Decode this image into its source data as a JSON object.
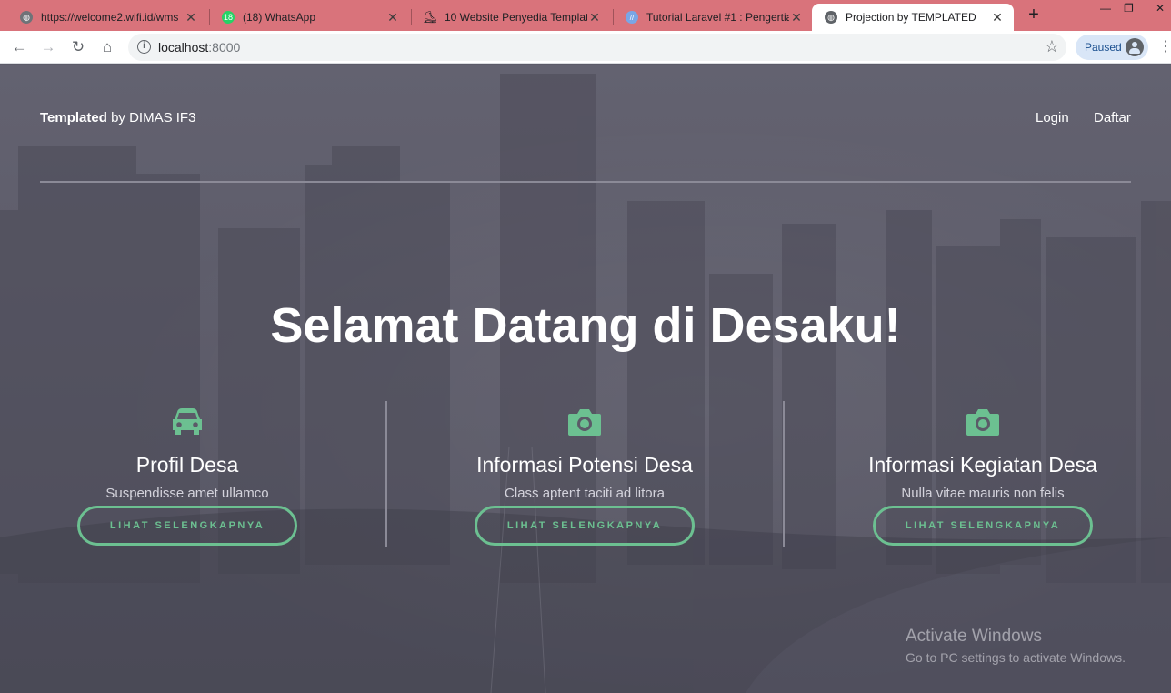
{
  "browser": {
    "tabs": [
      {
        "title": "https://welcome2.wifi.id/wms",
        "icon": "globe-icon",
        "active": false
      },
      {
        "title": "(18) WhatsApp",
        "icon": "whatsapp-icon",
        "badge": "18",
        "active": false
      },
      {
        "title": "10 Website Penyedia Templat",
        "icon": "site-icon",
        "active": false
      },
      {
        "title": "Tutorial Laravel #1 : Pengertia",
        "icon": "code-icon",
        "active": false
      },
      {
        "title": "Projection by TEMPLATED",
        "icon": "globe-icon",
        "active": true
      }
    ],
    "address": {
      "host": "localhost",
      "port": ":8000"
    },
    "profile_label": "Paused"
  },
  "header": {
    "brand_strong": "Templated",
    "brand_rest": " by DIMAS IF3",
    "nav": [
      {
        "label": "Login"
      },
      {
        "label": "Daftar"
      }
    ]
  },
  "hero": {
    "title": "Selamat Datang di Desaku!"
  },
  "features": [
    {
      "icon": "car-icon",
      "title": "Profil Desa",
      "text": "Suspendisse amet ullamco",
      "button": "LIHAT SELENGKAPNYA"
    },
    {
      "icon": "camera-icon",
      "title": "Informasi Potensi Desa",
      "text": "Class aptent taciti ad litora",
      "button": "LIHAT SELENGKAPNYA"
    },
    {
      "icon": "camera-icon",
      "title": "Informasi Kegiatan Desa",
      "text": "Nulla vitae mauris non felis",
      "button": "LIHAT SELENGKAPNYA"
    }
  ],
  "watermark": {
    "line1": "Activate Windows",
    "line2": "Go to PC settings to activate Windows."
  },
  "colors": {
    "accent": "#6cc091",
    "tabbar": "#d9737b",
    "overlay": "#5b5a68"
  }
}
